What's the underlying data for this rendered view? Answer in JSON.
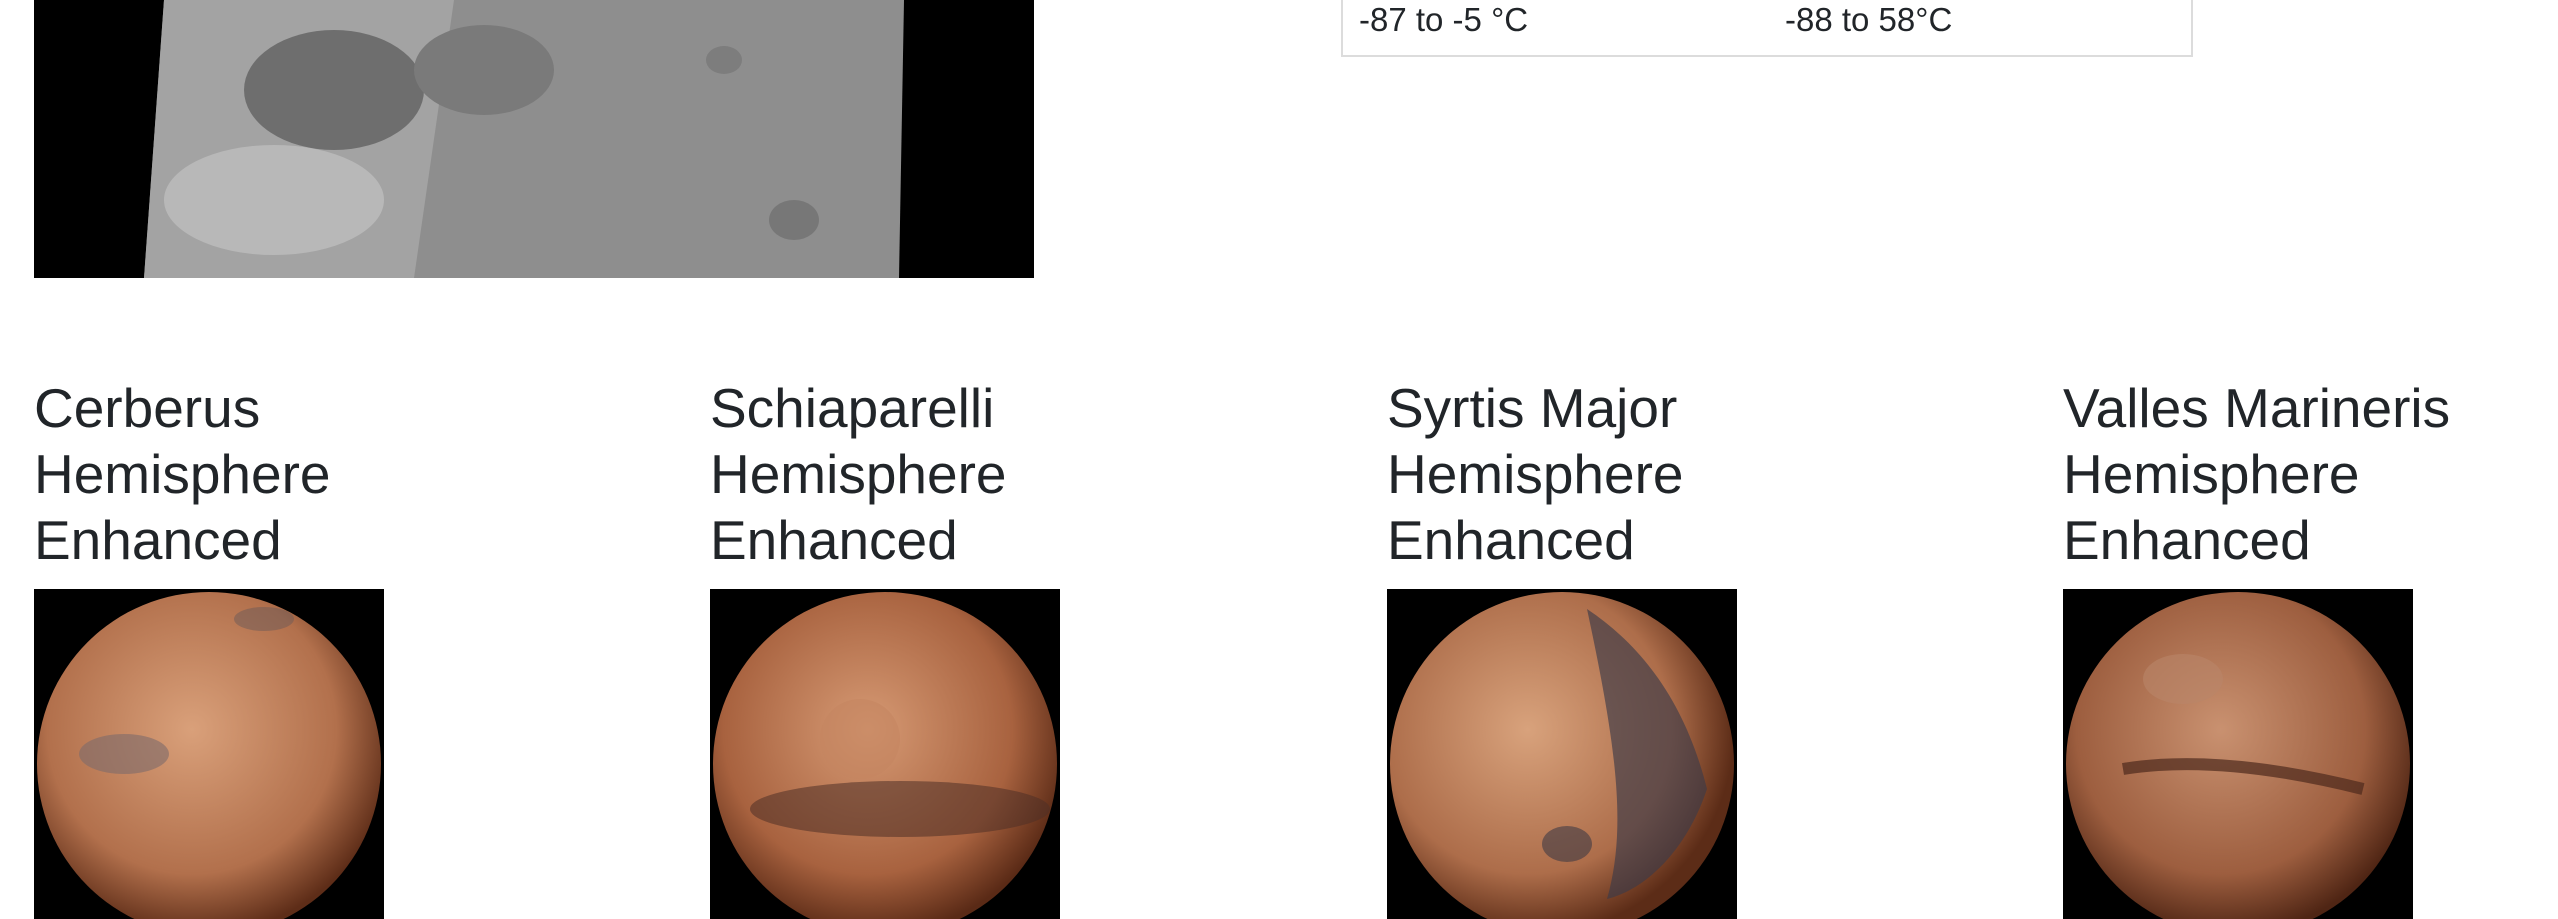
{
  "facts": {
    "row_values": [
      "-87 to -5 °C",
      "-88 to 58°C"
    ]
  },
  "hemispheres": [
    {
      "title": "Cerberus Hemisphere Enhanced",
      "image": "mars-cerberus-globe"
    },
    {
      "title": "Schiaparelli Hemisphere Enhanced",
      "image": "mars-schiaparelli-globe"
    },
    {
      "title": "Syrtis Major Hemisphere Enhanced",
      "image": "mars-syrtis-major-globe"
    },
    {
      "title": "Valles Marineris Hemisphere Enhanced",
      "image": "mars-valles-marineris-globe"
    }
  ],
  "colors": {
    "mars_light": "#c98a66",
    "mars_dark": "#7a3f25",
    "text": "#212529"
  }
}
